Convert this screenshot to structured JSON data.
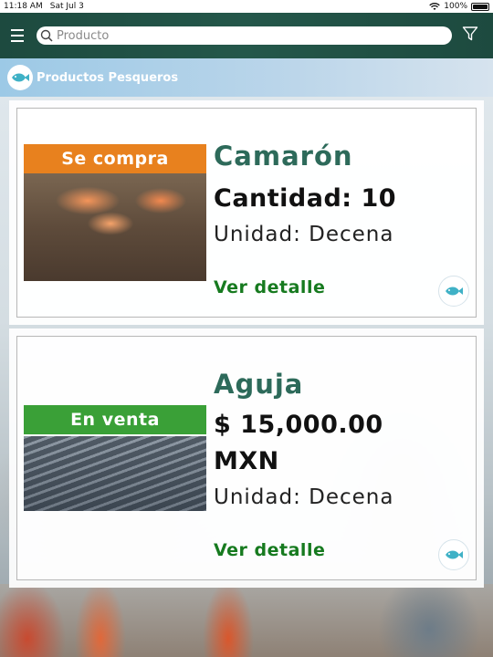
{
  "status_bar": {
    "time": "11:18 AM",
    "date": "Sat Jul 3",
    "battery": "100%"
  },
  "header": {
    "search_placeholder": "Producto"
  },
  "title_bar": {
    "title": "Productos Pesqueros"
  },
  "products": [
    {
      "badge": "Se compra",
      "name": "Camarón",
      "detail": "Cantidad: 10",
      "unit": "Unidad: Decena",
      "link": "Ver detalle"
    },
    {
      "badge": "En venta",
      "name": "Aguja",
      "price": "$ 15,000.00",
      "currency": "MXN",
      "unit": "Unidad: Decena",
      "link": "Ver detalle"
    }
  ],
  "colors": {
    "header": "#1d4a3f",
    "buy_badge": "#e8811e",
    "sell_badge": "#3aa037",
    "link": "#167a1f",
    "fish_icon": "#3fb1c6"
  }
}
